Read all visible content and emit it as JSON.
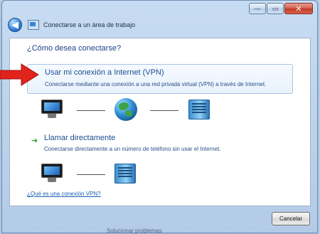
{
  "window": {
    "title": "Conectarse a un área de trabajo",
    "minimize_glyph": "—",
    "maximize_glyph": "▭",
    "close_glyph": "✕"
  },
  "header": {
    "back_glyph": "◀"
  },
  "content": {
    "question": "¿Cómo desea conectarse?",
    "options": [
      {
        "title": "Usar mi conexión a Internet (VPN)",
        "description": "Conectarse mediante una conexión a una red privada virtual (VPN) a través de Internet.",
        "icons": [
          "computer-icon",
          "globe-icon",
          "server-icon"
        ]
      },
      {
        "title": "Llamar directamente",
        "description": "Conectarse directamente a un número de teléfono sin usar el Internet.",
        "arrow_glyph": "➔",
        "icons": [
          "computer-icon",
          "server-icon"
        ]
      }
    ],
    "help_link": "¿Qué es una conexión VPN?"
  },
  "footer": {
    "cancel_label": "Cancelar"
  },
  "background_text": "Solucionar problemas",
  "colors": {
    "accent_link": "#1a5fb4",
    "highlight_arrow": "#e0231b",
    "direct_arrow": "#2e9e2e"
  }
}
